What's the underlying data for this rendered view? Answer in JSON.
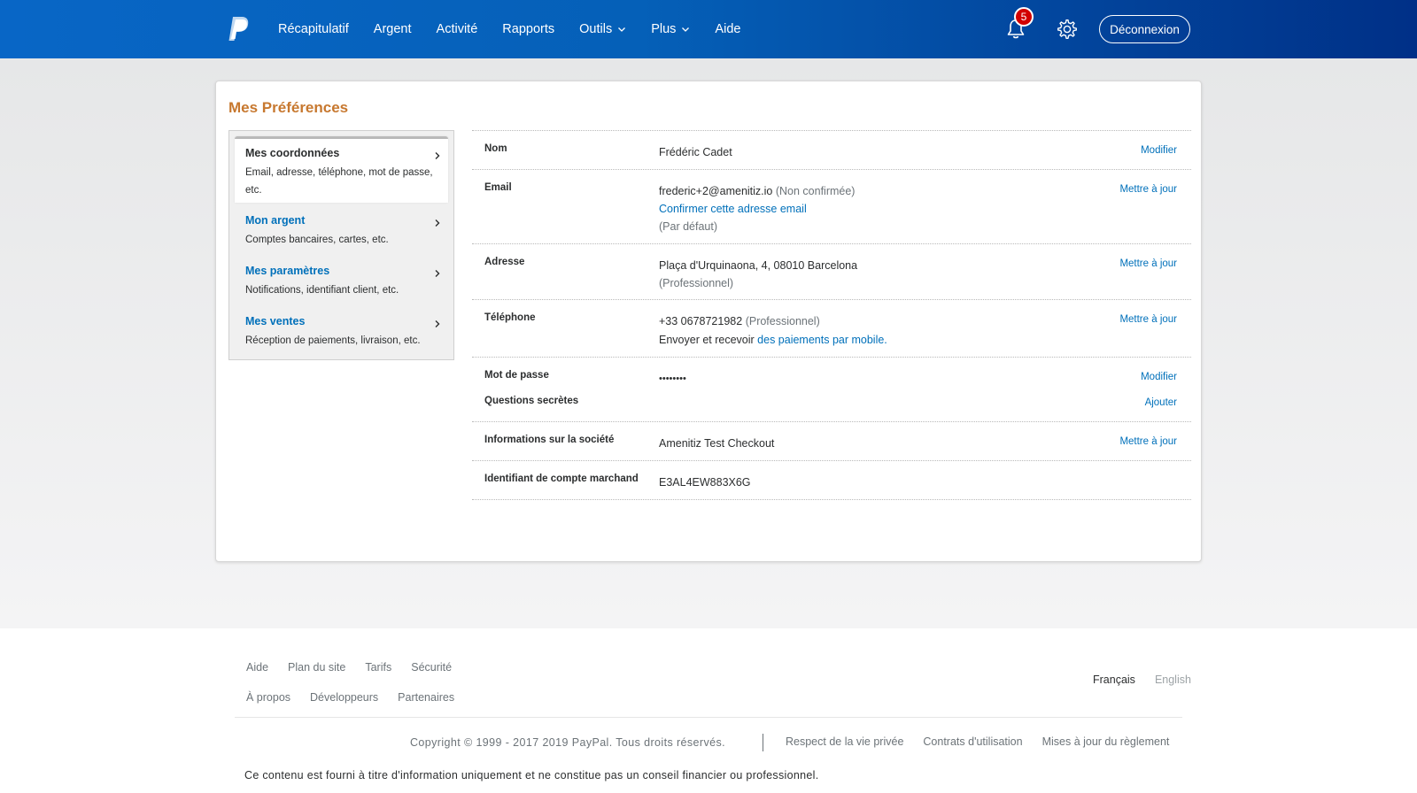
{
  "header": {
    "nav": [
      {
        "label": "Récapitulatif"
      },
      {
        "label": "Argent"
      },
      {
        "label": "Activité"
      },
      {
        "label": "Rapports"
      },
      {
        "label": "Outils",
        "dropdown": true
      },
      {
        "label": "Plus",
        "dropdown": true
      },
      {
        "label": "Aide"
      }
    ],
    "notifications_count": "5",
    "logout_label": "Déconnexion",
    "icons": [
      "paypal-logo",
      "bell-icon",
      "gear-icon",
      "chevron-down-icon"
    ],
    "colors": {
      "bar_start": "#0866c6",
      "bar_end": "#003087",
      "badge": "#d20000"
    }
  },
  "page": {
    "title": "Mes Préférences",
    "title_color": "#c7782f"
  },
  "sidebar": {
    "items": [
      {
        "title": "Mes coordonnées",
        "desc": "Email, adresse, téléphone, mot de passe, etc.",
        "active": true
      },
      {
        "title": "Mon argent",
        "desc": "Comptes bancaires, cartes, etc."
      },
      {
        "title": "Mes paramètres",
        "desc": "Notifications, identifiant client, etc."
      },
      {
        "title": "Mes ventes",
        "desc": "Réception de paiements, livraison, etc."
      }
    ]
  },
  "details": {
    "nom": {
      "label": "Nom",
      "value": "Frédéric Cadet",
      "action": "Modifier"
    },
    "email": {
      "label": "Email",
      "value": "frederic+2@amenitiz.io",
      "status": "(Non confirmée)",
      "confirm_link": "Confirmer cette adresse email",
      "default_note": "(Par défaut)",
      "action": "Mettre à jour"
    },
    "adresse": {
      "label": "Adresse",
      "value": "Plaça d'Urquinaona, 4, 08010 Barcelona",
      "type": "(Professionnel)",
      "action": "Mettre à jour"
    },
    "telephone": {
      "label": "Téléphone",
      "value": "+33 0678721982",
      "type": "(Professionnel)",
      "mobile_text": "Envoyer et recevoir",
      "mobile_link": "des paiements par mobile.",
      "action": "Mettre à jour"
    },
    "password": {
      "label": "Mot de passe",
      "value": "••••••••",
      "action": "Modifier"
    },
    "questions": {
      "label": "Questions secrètes",
      "action": "Ajouter"
    },
    "societe": {
      "label": "Informations sur la société",
      "value": "Amenitiz Test Checkout",
      "action": "Mettre à jour"
    },
    "marchand": {
      "label": "Identifiant de compte marchand",
      "value": "E3AL4EW883X6G"
    }
  },
  "footer": {
    "links_row1": [
      "Aide",
      "Plan du site",
      "Tarifs",
      "Sécurité"
    ],
    "links_row2": [
      "À propos",
      "Développeurs",
      "Partenaires"
    ],
    "languages": {
      "active": "Français",
      "other": "English"
    },
    "copyright": "Copyright © 1999 - 2017 2019 PayPal. Tous droits réservés.",
    "legal": [
      "Respect de la vie privée",
      "Contrats d'utilisation",
      "Mises à jour du règlement"
    ],
    "disclaimer": "Ce contenu est fourni à titre d'information uniquement et ne constitue pas un conseil financier ou professionnel."
  }
}
